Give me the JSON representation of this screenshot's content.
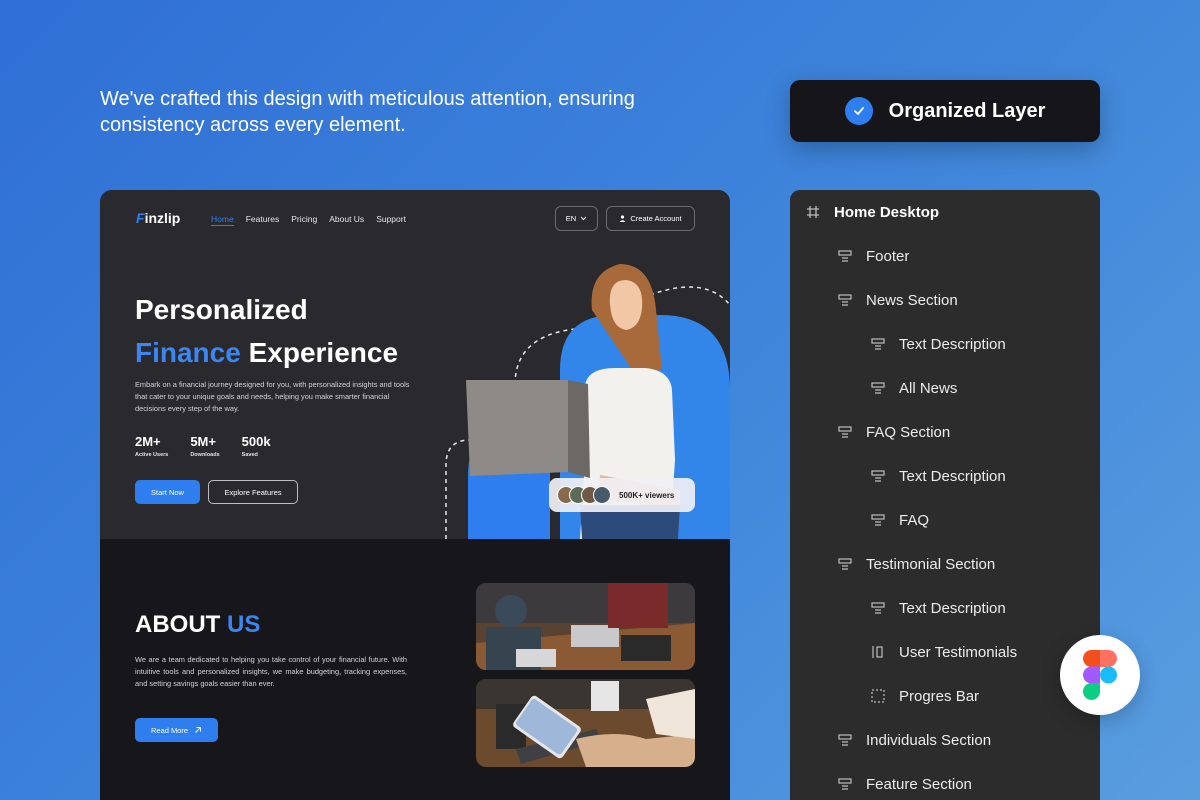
{
  "header": {
    "tagline": "We've crafted this design with meticulous attention, ensuring consistency across every element.",
    "badge_label": "Organized Layer",
    "badge_icon": "check-icon"
  },
  "mockup": {
    "logo_first": "F",
    "logo_rest": "inzlip",
    "nav": [
      "Home",
      "Features",
      "Pricing",
      "About Us",
      "Support"
    ],
    "active_nav": "Home",
    "lang": "EN",
    "create_account": "Create Account",
    "hero": {
      "title_line1": "Personalized",
      "title_highlight": "Finance",
      "title_rest": " Experience",
      "description": "Embark on a financial journey designed for you, with personalized insights and tools that cater to your unique goals and needs, helping you make smarter financial decisions every step of the way.",
      "stats": [
        {
          "value": "2M+",
          "label": "Active Users"
        },
        {
          "value": "5M+",
          "label": "Downloads"
        },
        {
          "value": "500k",
          "label": "Saved"
        }
      ],
      "primary_button": "Start Now",
      "secondary_button": "Explore Features",
      "viewers": "500K+ viewers"
    },
    "about": {
      "title_main": "ABOUT",
      "title_highlight": " US",
      "description": "We are a team dedicated to helping you take control of your financial future. With intuitive tools and personalized insights, we make budgeting, tracking expenses, and setting savings goals easier than ever.",
      "button": "Read More"
    }
  },
  "layers": {
    "root": "Home Desktop",
    "items": [
      {
        "label": "Footer",
        "icon": "section-icon"
      },
      {
        "label": "News Section",
        "icon": "section-icon"
      },
      {
        "label": "Text Description",
        "icon": "section-icon"
      },
      {
        "label": "All News",
        "icon": "section-icon"
      },
      {
        "label": "FAQ Section",
        "icon": "section-icon"
      },
      {
        "label": "Text Description",
        "icon": "section-icon"
      },
      {
        "label": "FAQ",
        "icon": "section-icon"
      },
      {
        "label": "Testimonial Section",
        "icon": "section-icon"
      },
      {
        "label": "Text Description",
        "icon": "section-icon"
      },
      {
        "label": "User Testimonials",
        "icon": "horizontal-layout-icon"
      },
      {
        "label": "Progres Bar",
        "icon": "dashed-frame-icon"
      },
      {
        "label": "Individuals Section",
        "icon": "section-icon"
      },
      {
        "label": "Feature Section",
        "icon": "section-icon"
      }
    ]
  },
  "colors": {
    "accent": "#2f7ef0",
    "panel": "#2c2c2c",
    "dark": "#17171b"
  }
}
